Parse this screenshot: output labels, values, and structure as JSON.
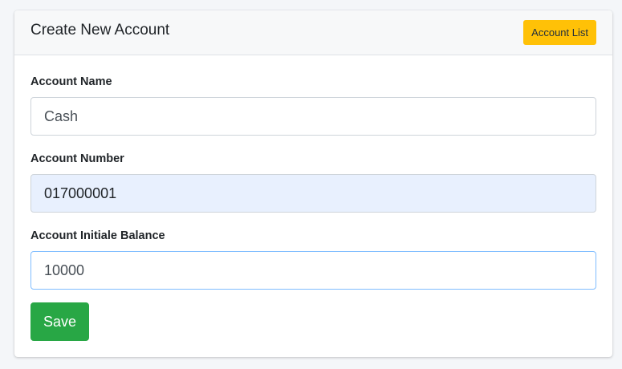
{
  "header": {
    "title": "Create New Account",
    "list_button_label": "Account List"
  },
  "form": {
    "account_name": {
      "label": "Account Name",
      "value": "Cash"
    },
    "account_number": {
      "label": "Account Number",
      "value": "017000001"
    },
    "initial_balance": {
      "label": "Account Initiale Balance",
      "value": "10000"
    },
    "save_label": "Save"
  },
  "colors": {
    "list_button": "#ffc107",
    "save_button": "#28a745",
    "autofill_bg": "#e8f0fe",
    "focus_border": "#80bdff"
  }
}
